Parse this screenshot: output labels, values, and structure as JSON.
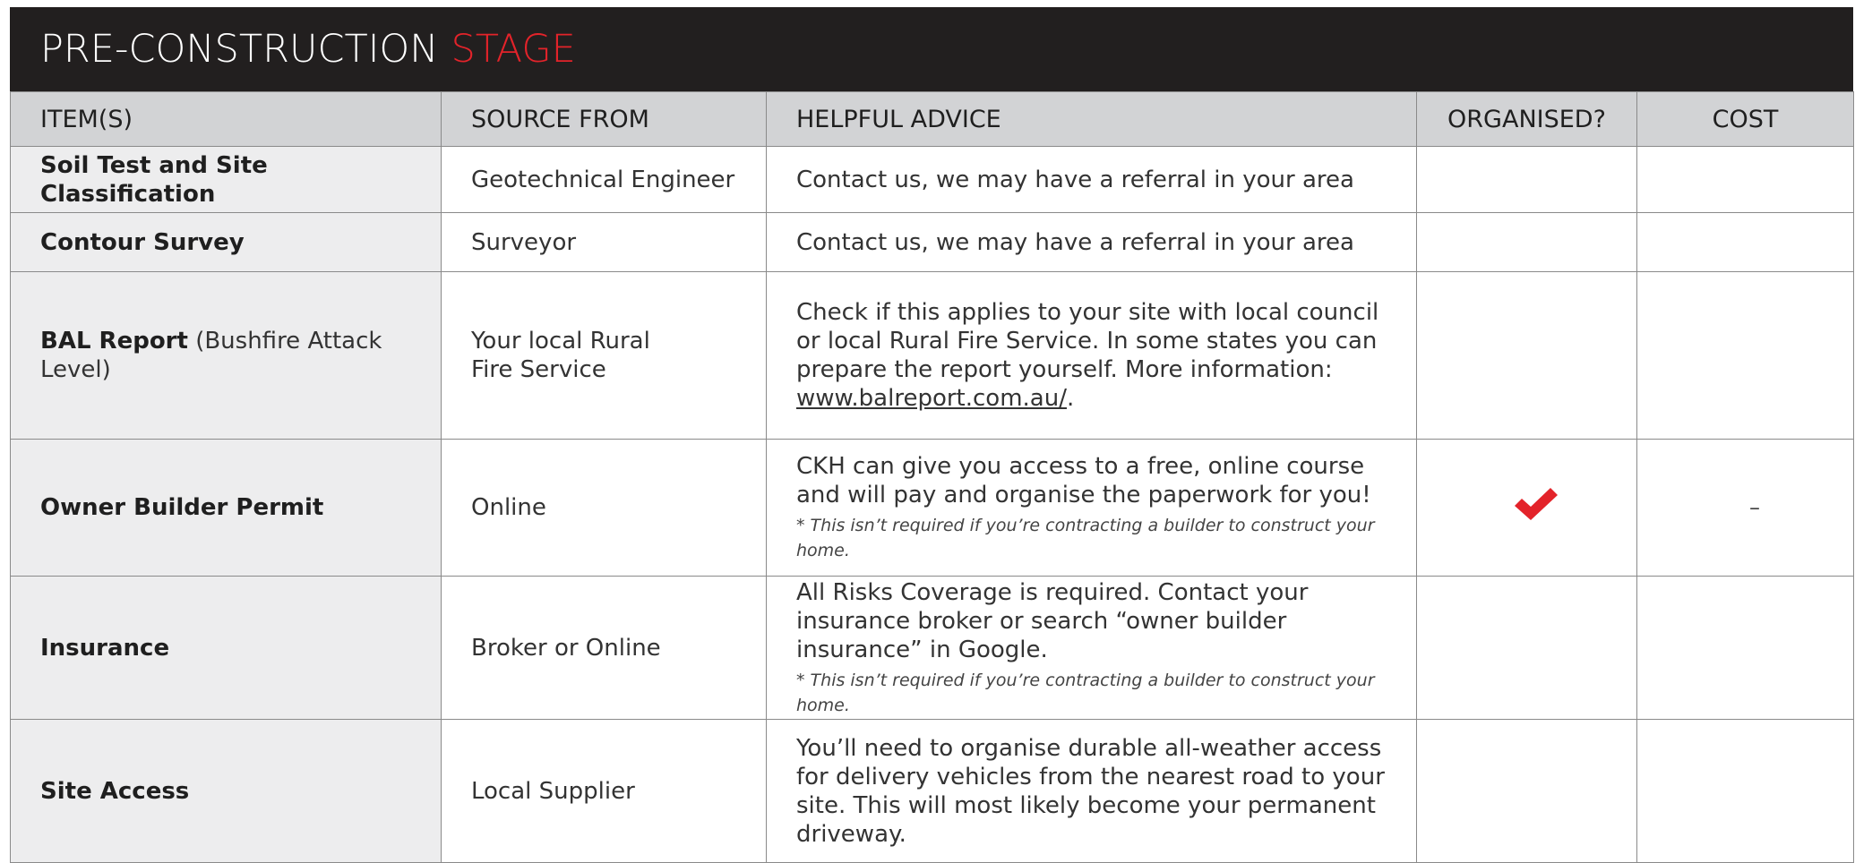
{
  "title": {
    "main": "PRE-CONSTRUCTION",
    "accent": "STAGE"
  },
  "columns": {
    "item": "ITEM(S)",
    "source": "SOURCE FROM",
    "advice": "HELPFUL ADVICE",
    "organised": "ORGANISED?",
    "cost": "COST"
  },
  "colors": {
    "header_bg": "#221f1f",
    "accent": "#e3232a",
    "column_header_bg": "#d2d3d5",
    "item_cell_bg": "#ededee"
  },
  "rows": [
    {
      "item": "Soil Test and Site Classification",
      "item_extra": "",
      "source": "Geotechnical Engineer",
      "advice": "Contact us, we may have a referral in your area",
      "advice_link": "",
      "advice_link_suffix": "",
      "note": "",
      "organised": "",
      "cost": ""
    },
    {
      "item": "Contour Survey",
      "item_extra": "",
      "source": "Surveyor",
      "advice": "Contact us, we may have a referral in your area",
      "advice_link": "",
      "advice_link_suffix": "",
      "note": "",
      "organised": "",
      "cost": ""
    },
    {
      "item": "BAL Report",
      "item_extra": "(Bushfire Attack Level)",
      "source": "Your local Rural Fire Service",
      "advice": "Check if this applies to your site with local council or local Rural Fire Service. In some states you can prepare the report yourself. More information: ",
      "advice_link": "www.balreport.com.au/",
      "advice_link_suffix": ".",
      "note": "",
      "organised": "",
      "cost": ""
    },
    {
      "item": "Owner Builder Permit",
      "item_extra": "",
      "source": "Online",
      "advice": "CKH can give you access to a free, online course and will pay and organise the paperwork for you!",
      "advice_link": "",
      "advice_link_suffix": "",
      "note": "* This isn’t required if you’re contracting a builder to construct your home.",
      "organised": "checkmark-icon",
      "cost": "–"
    },
    {
      "item": "Insurance",
      "item_extra": "",
      "source": "Broker or Online",
      "advice": "All Risks Coverage is required. Contact your insurance broker or search “owner builder insurance” in Google.",
      "advice_link": "",
      "advice_link_suffix": "",
      "note": "* This isn’t required if you’re contracting a builder to construct your home.",
      "organised": "",
      "cost": ""
    },
    {
      "item": "Site Access",
      "item_extra": "",
      "source": "Local Supplier",
      "advice": "You’ll need to organise durable all-weather access for delivery vehicles from the nearest road to your site. This will most likely become your permanent driveway.",
      "advice_link": "",
      "advice_link_suffix": "",
      "note": "",
      "organised": "",
      "cost": ""
    }
  ]
}
